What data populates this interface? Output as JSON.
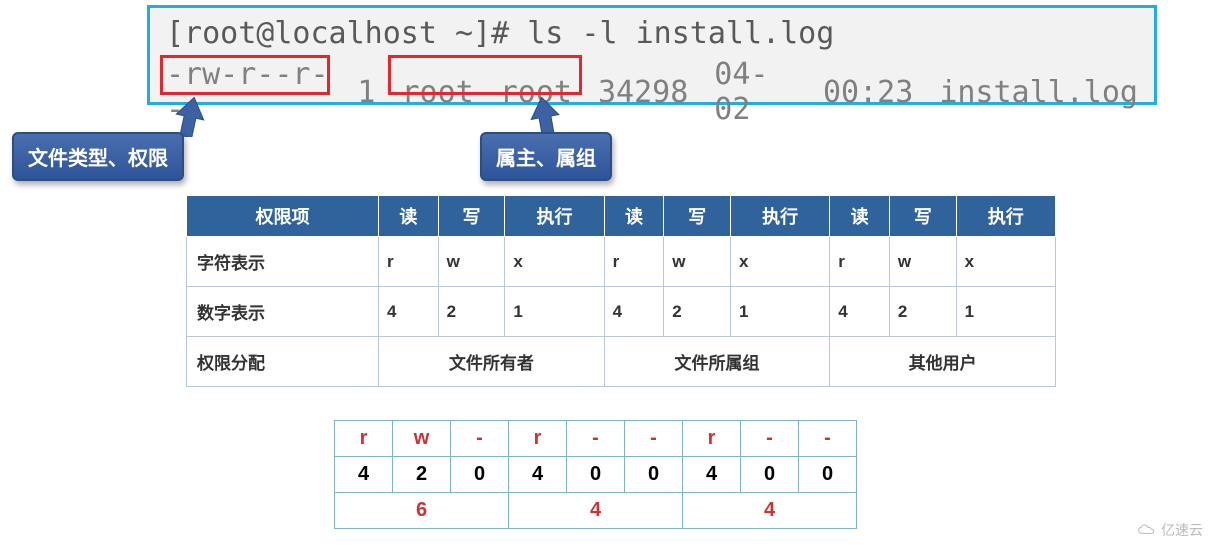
{
  "terminal": {
    "prompt_line": "[root@localhost ~]# ls -l install.log",
    "perm": "-rw-r--r--",
    "links": "1",
    "owner": "root",
    "group": "root",
    "size": "34298",
    "date": "04-02",
    "time": "00:23",
    "name": "install.log"
  },
  "callouts": {
    "c1": "文件类型、权限",
    "c2": "属主、属组"
  },
  "permTable": {
    "headers": [
      "权限项",
      "读",
      "写",
      "执行",
      "读",
      "写",
      "执行",
      "读",
      "写",
      "执行"
    ],
    "row1_label": "字符表示",
    "row1": [
      "r",
      "w",
      "x",
      "r",
      "w",
      "x",
      "r",
      "w",
      "x"
    ],
    "row2_label": "数字表示",
    "row2": [
      "4",
      "2",
      "1",
      "4",
      "2",
      "1",
      "4",
      "2",
      "1"
    ],
    "row3_label": "权限分配",
    "row3": [
      "文件所有者",
      "文件所属组",
      "其他用户"
    ]
  },
  "octal": {
    "chars": [
      "r",
      "w",
      "-",
      "r",
      "-",
      "-",
      "r",
      "-",
      "-"
    ],
    "nums": [
      "4",
      "2",
      "0",
      "4",
      "0",
      "0",
      "4",
      "0",
      "0"
    ],
    "sums": [
      "6",
      "4",
      "4"
    ]
  },
  "watermark": "亿速云"
}
